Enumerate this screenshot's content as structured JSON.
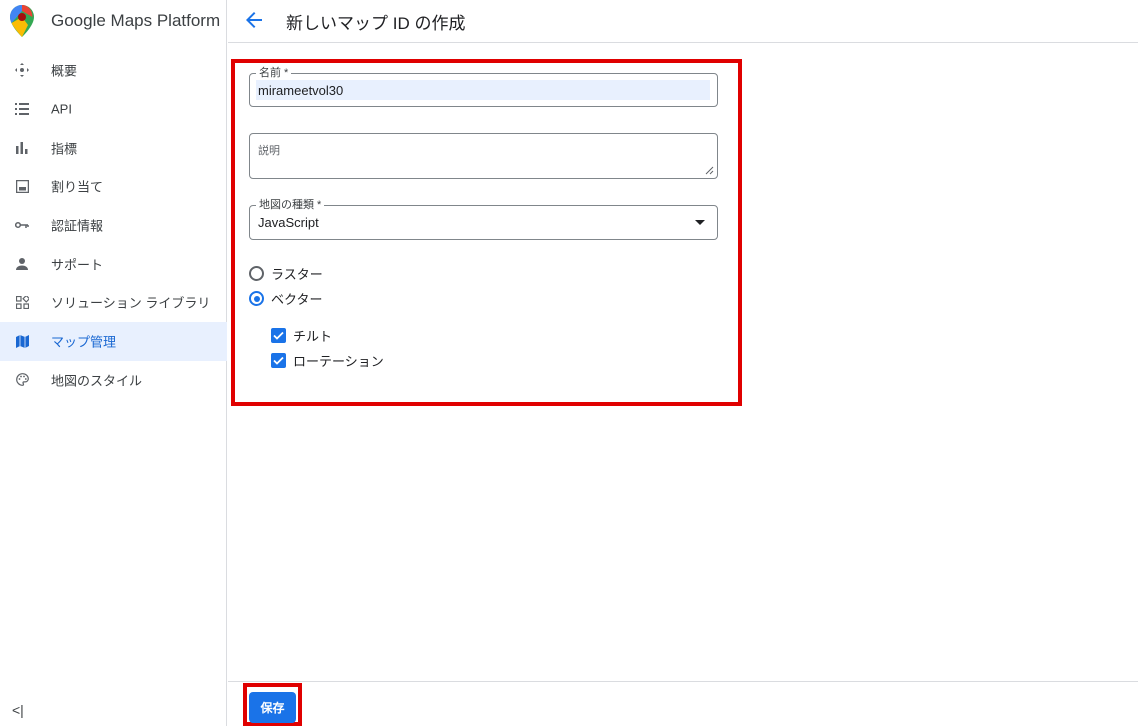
{
  "brand": {
    "title": "Google Maps Platform"
  },
  "header": {
    "title": "新しいマップ ID の作成"
  },
  "sidebar": {
    "items": [
      {
        "label": "概要",
        "icon": "overview-icon"
      },
      {
        "label": "API",
        "icon": "list-icon"
      },
      {
        "label": "指標",
        "icon": "bar-chart-icon"
      },
      {
        "label": "割り当て",
        "icon": "quota-icon"
      },
      {
        "label": "認証情報",
        "icon": "key-icon"
      },
      {
        "label": "サポート",
        "icon": "person-icon"
      },
      {
        "label": "ソリューション ライブラリ",
        "icon": "solutions-icon"
      },
      {
        "label": "マップ管理",
        "icon": "map-icon",
        "active": true
      },
      {
        "label": "地図のスタイル",
        "icon": "palette-icon"
      }
    ],
    "collapse_label": "<|"
  },
  "form": {
    "name": {
      "label": "名前 *",
      "value": "mirameetvol30"
    },
    "description": {
      "label": "説明",
      "value": ""
    },
    "map_type": {
      "label": "地図の種類 *",
      "value": "JavaScript"
    },
    "radios": [
      {
        "label": "ラスター",
        "checked": false
      },
      {
        "label": "ベクター",
        "checked": true
      }
    ],
    "checkboxes": [
      {
        "label": "チルト",
        "checked": true
      },
      {
        "label": "ローテーション",
        "checked": true
      }
    ]
  },
  "footer": {
    "save_label": "保存"
  },
  "colors": {
    "accent": "#1a73e8",
    "highlight": "#e00000",
    "active_bg": "#e8f0fe"
  }
}
